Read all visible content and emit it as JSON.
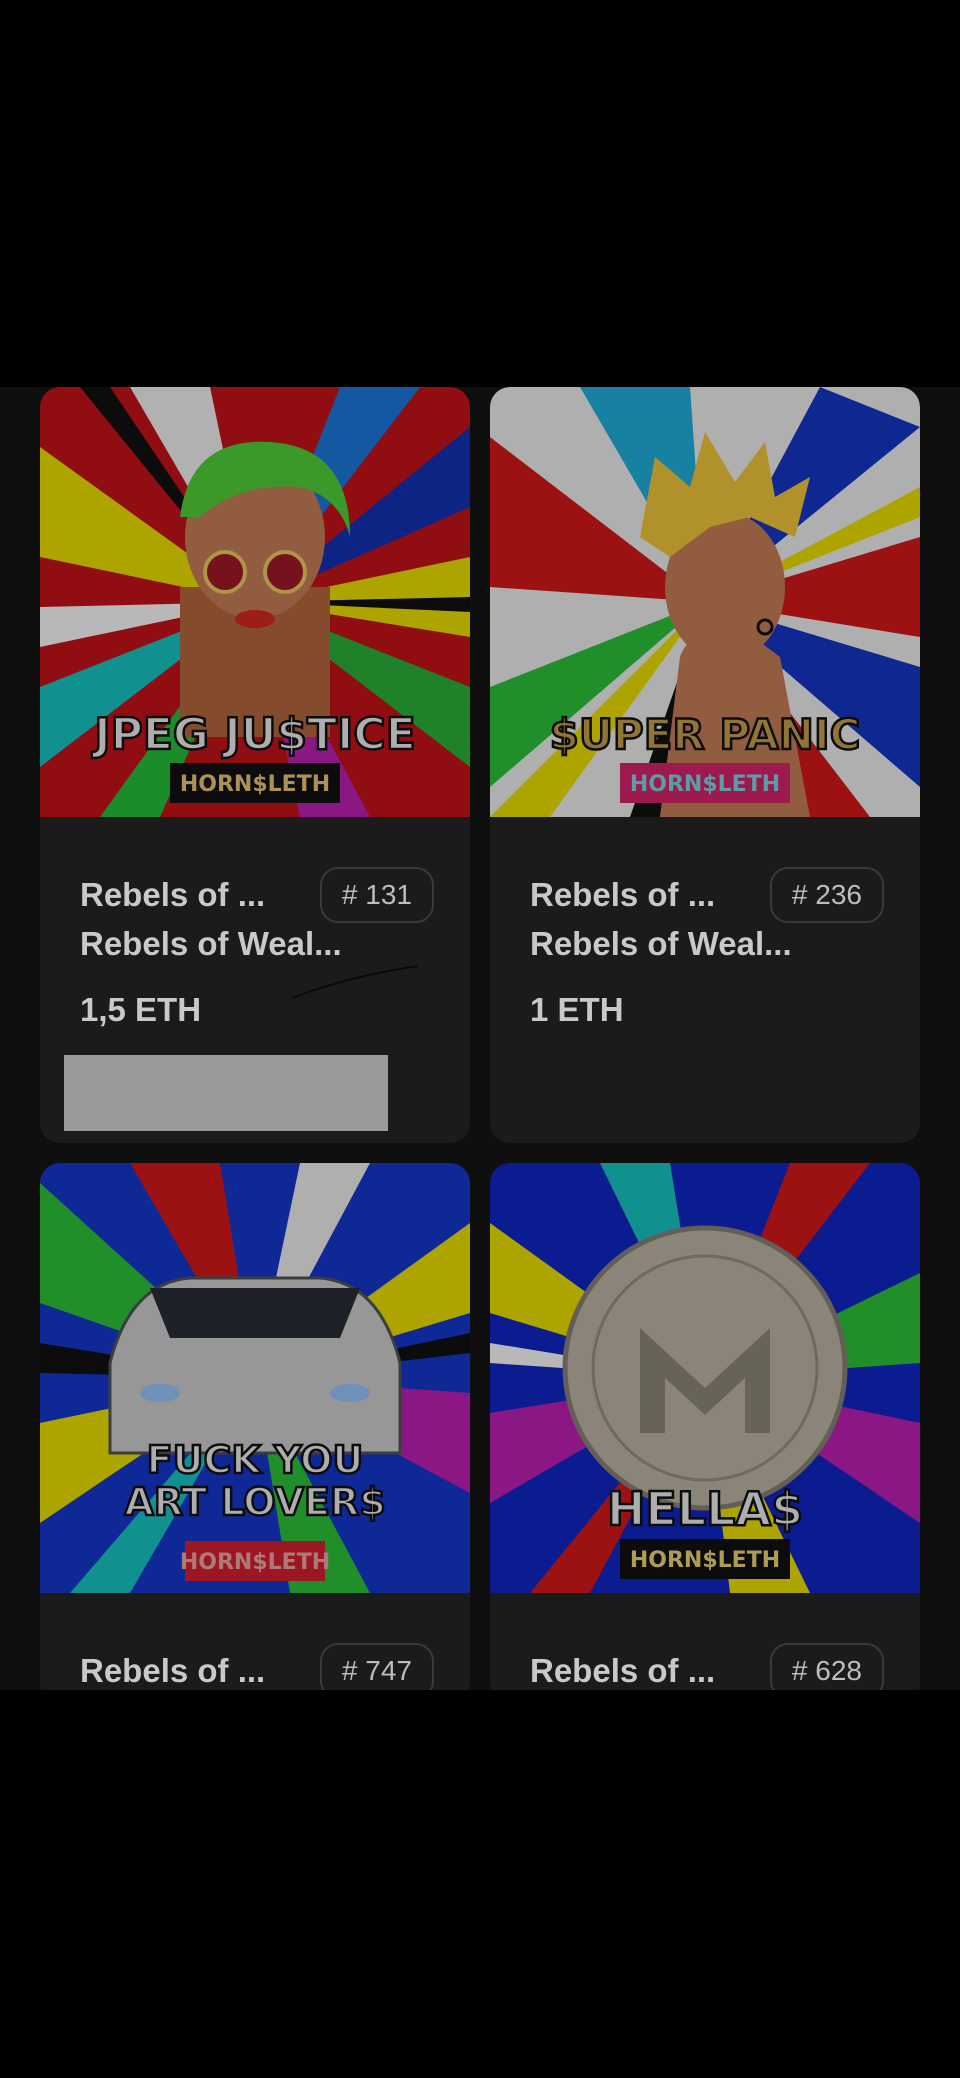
{
  "cards": [
    {
      "art_title": "JPEG JU$TICE",
      "art_signature": "HORN$LETH",
      "collection": "Rebels of ...",
      "token_badge": "# 131",
      "name": "Rebels of Weal...",
      "price": "1,5 ETH"
    },
    {
      "art_title": "$UPER PANIC",
      "art_signature": "HORN$LETH",
      "collection": "Rebels of ...",
      "token_badge": "# 236",
      "name": "Rebels of Weal...",
      "price": "1 ETH"
    },
    {
      "art_title_line1": "FUCK YOU",
      "art_title_line2": "ART LOVER$",
      "art_signature": "HORN$LETH",
      "collection": "Rebels of ...",
      "token_badge": "# 747"
    },
    {
      "art_title": "HELLA$",
      "art_signature": "HORN$LETH",
      "collection": "Rebels of ...",
      "token_badge": "# 628"
    }
  ],
  "colors": {
    "page_background": "#000000",
    "card_background": "#1b1b1c",
    "text": "#c9c9c9"
  }
}
